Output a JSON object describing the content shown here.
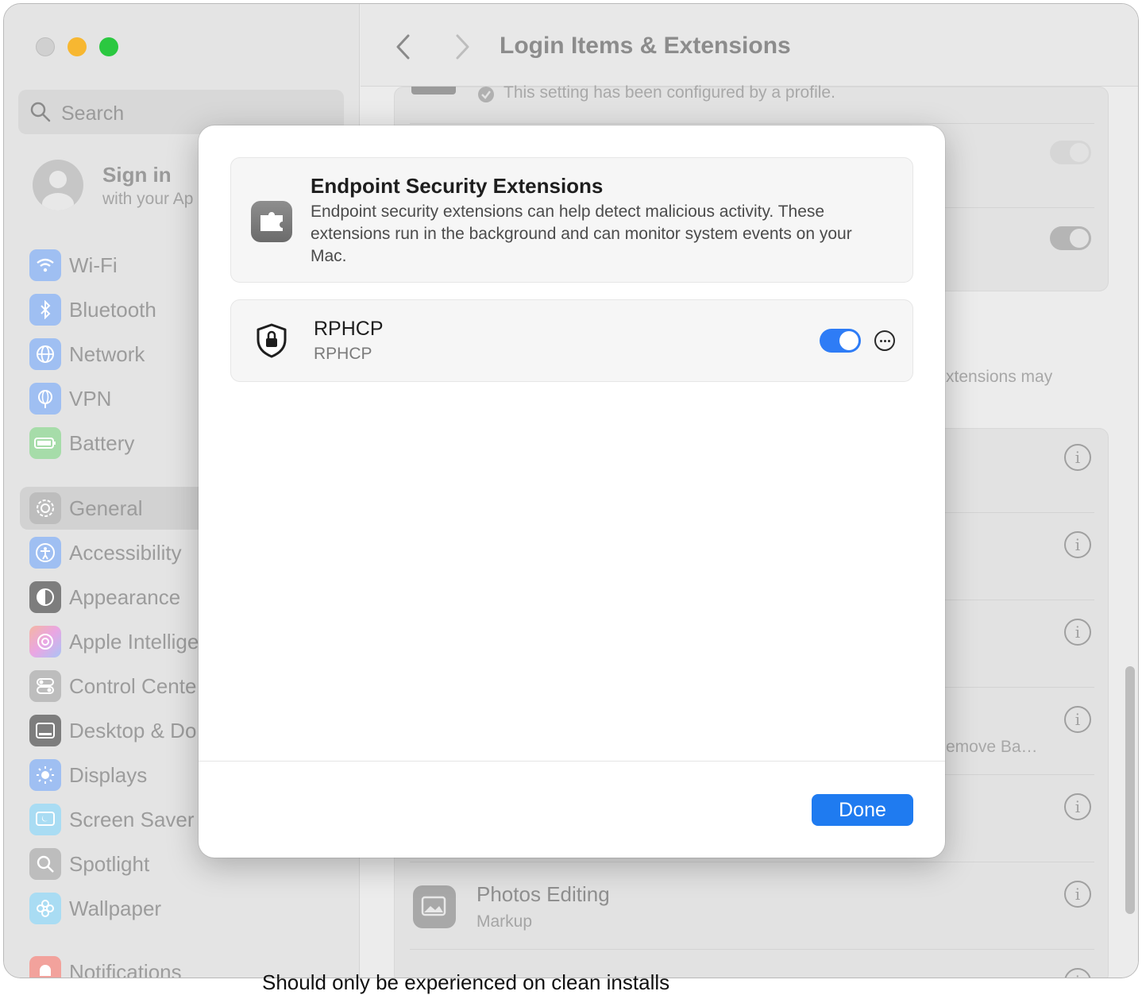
{
  "window": {
    "title": "Login Items & Extensions"
  },
  "sidebar": {
    "search_placeholder": "Search",
    "signin": {
      "title": "Sign in",
      "subtitle": "with your Ap"
    },
    "items": [
      {
        "label": "Wi-Fi",
        "icon": "wifi-icon",
        "color": "#2f7cf6"
      },
      {
        "label": "Bluetooth",
        "icon": "bluetooth-icon",
        "color": "#2f7cf6"
      },
      {
        "label": "Network",
        "icon": "globe-icon",
        "color": "#2f7cf6"
      },
      {
        "label": "VPN",
        "icon": "vpn-globe-icon",
        "color": "#2f7cf6"
      },
      {
        "label": "Battery",
        "icon": "battery-icon",
        "color": "#34c759"
      },
      {
        "label": "General",
        "icon": "gear-icon",
        "color": "#8e8e93",
        "selected": true
      },
      {
        "label": "Accessibility",
        "icon": "accessibility-icon",
        "color": "#2f7cf6"
      },
      {
        "label": "Appearance",
        "icon": "appearance-icon",
        "color": "#1c1c1e"
      },
      {
        "label": "Apple Intellige",
        "icon": "apple-intelligence-icon",
        "color": "#e88ad8"
      },
      {
        "label": "Control Cente",
        "icon": "control-center-icon",
        "color": "#8e8e93"
      },
      {
        "label": "Desktop & Do",
        "icon": "desktop-dock-icon",
        "color": "#1c1c1e"
      },
      {
        "label": "Displays",
        "icon": "displays-icon",
        "color": "#2f7cf6"
      },
      {
        "label": "Screen Saver",
        "icon": "screen-saver-icon",
        "color": "#5ac8fa"
      },
      {
        "label": "Spotlight",
        "icon": "spotlight-icon",
        "color": "#8e8e93"
      },
      {
        "label": "Wallpaper",
        "icon": "wallpaper-icon",
        "color": "#5ac8fa"
      },
      {
        "label": "Notifications",
        "icon": "notifications-icon",
        "color": "#ff3b30"
      }
    ]
  },
  "background": {
    "profile_note": "This setting has been configured by a profile.",
    "extensions_may": "xtensions may",
    "remove_ba": "emove Ba…",
    "photos_editing": {
      "title": "Photos Editing",
      "subtitle": "Markup"
    }
  },
  "sheet": {
    "info": {
      "title": "Endpoint Security Extensions",
      "description": "Endpoint security extensions can help detect malicious activity. These extensions run in the background and can monitor system events on your Mac."
    },
    "extension": {
      "name": "RPHCP",
      "subtitle": "RPHCP",
      "enabled": true
    },
    "done_label": "Done"
  },
  "overlay_text": "Should only be experienced on clean installs"
}
